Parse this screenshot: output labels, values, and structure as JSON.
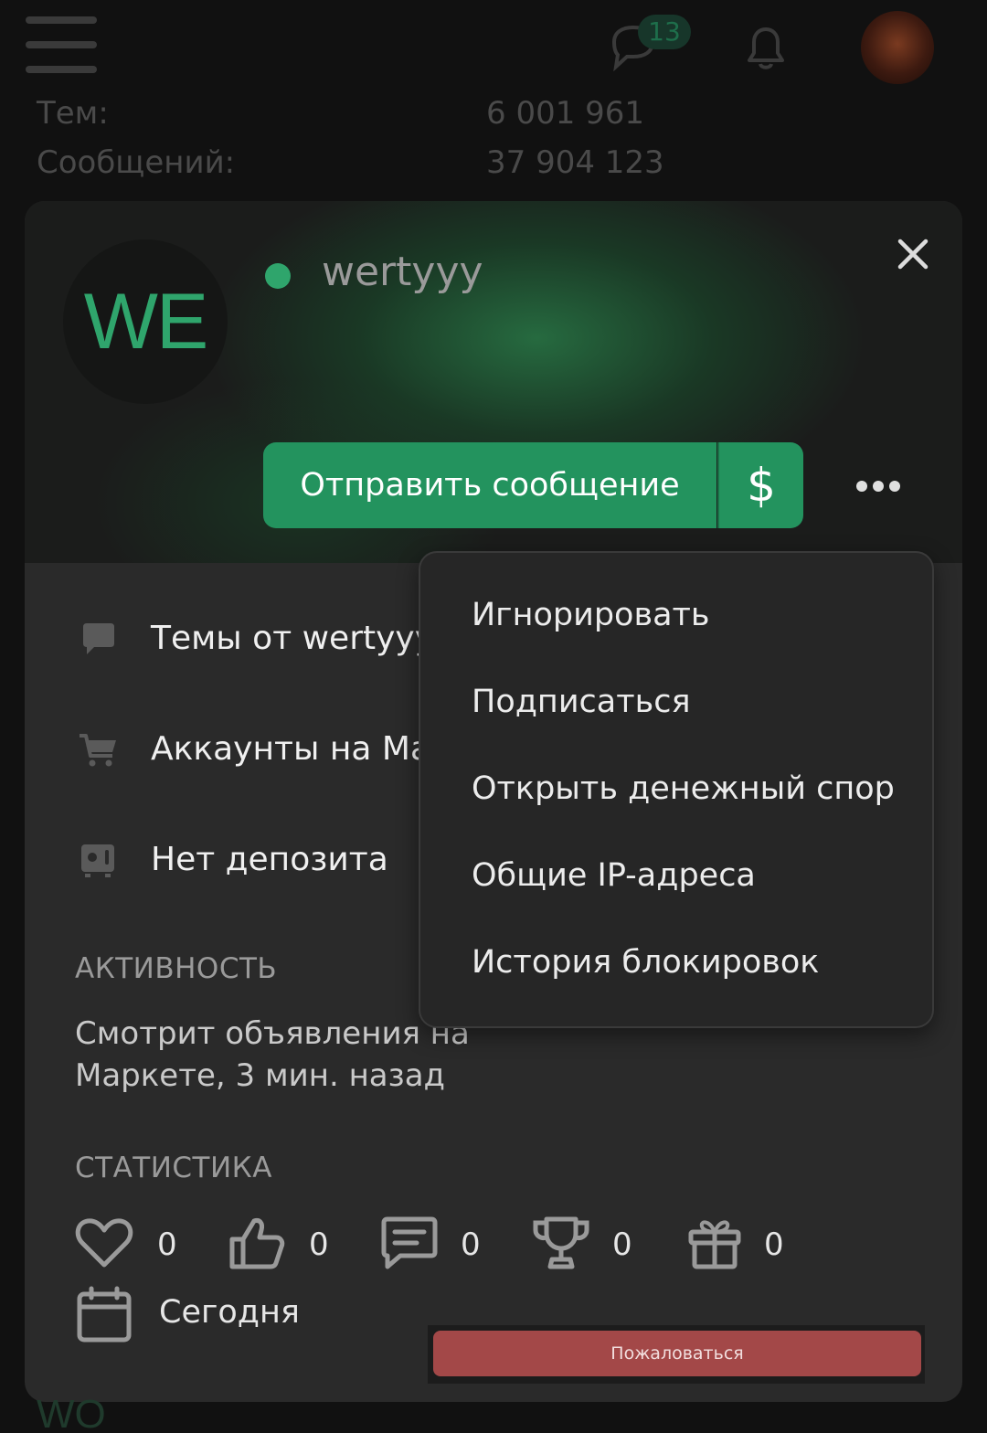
{
  "topbar": {
    "chat_badge": "13"
  },
  "background_stats": [
    {
      "label": "Тем:",
      "value": "6 001 961"
    },
    {
      "label": "Сообщений:",
      "value": "37 904 123"
    }
  ],
  "profile": {
    "avatar_initials": "WE",
    "username": "wertyyy",
    "online": true,
    "send_message_label": "Отправить сообщение",
    "pay_label": "$",
    "links": [
      {
        "icon": "speech-bubble-icon",
        "label": "Темы от wertyyy"
      },
      {
        "icon": "cart-icon",
        "label": "Аккаунты на Ма"
      },
      {
        "icon": "safe-icon",
        "label": "Нет депозита"
      }
    ],
    "activity_heading": "АКТИВНОСТЬ",
    "activity_line1": "Смотрит объявления на",
    "activity_line2": "Маркете, 3 мин. назад",
    "stats_heading": "СТАТИСТИКА",
    "stats": [
      {
        "icon": "heart-icon",
        "value": "0"
      },
      {
        "icon": "thumbs-up-icon",
        "value": "0"
      },
      {
        "icon": "message-icon",
        "value": "0"
      },
      {
        "icon": "trophy-icon",
        "value": "0"
      },
      {
        "icon": "gift-icon",
        "value": "0"
      }
    ],
    "registered_label": "Сегодня",
    "report_label": "Пожаловаться"
  },
  "menu": {
    "items": [
      "Игнорировать",
      "Подписаться",
      "Открыть денежный спор",
      "Общие IP-адреса",
      "История блокировок"
    ]
  },
  "under_card": {
    "avatar_fragment": "WO"
  },
  "colors": {
    "accent": "#23935e",
    "online": "#2fa56c",
    "danger": "#a34848",
    "card_bg": "#2a2a2a"
  }
}
